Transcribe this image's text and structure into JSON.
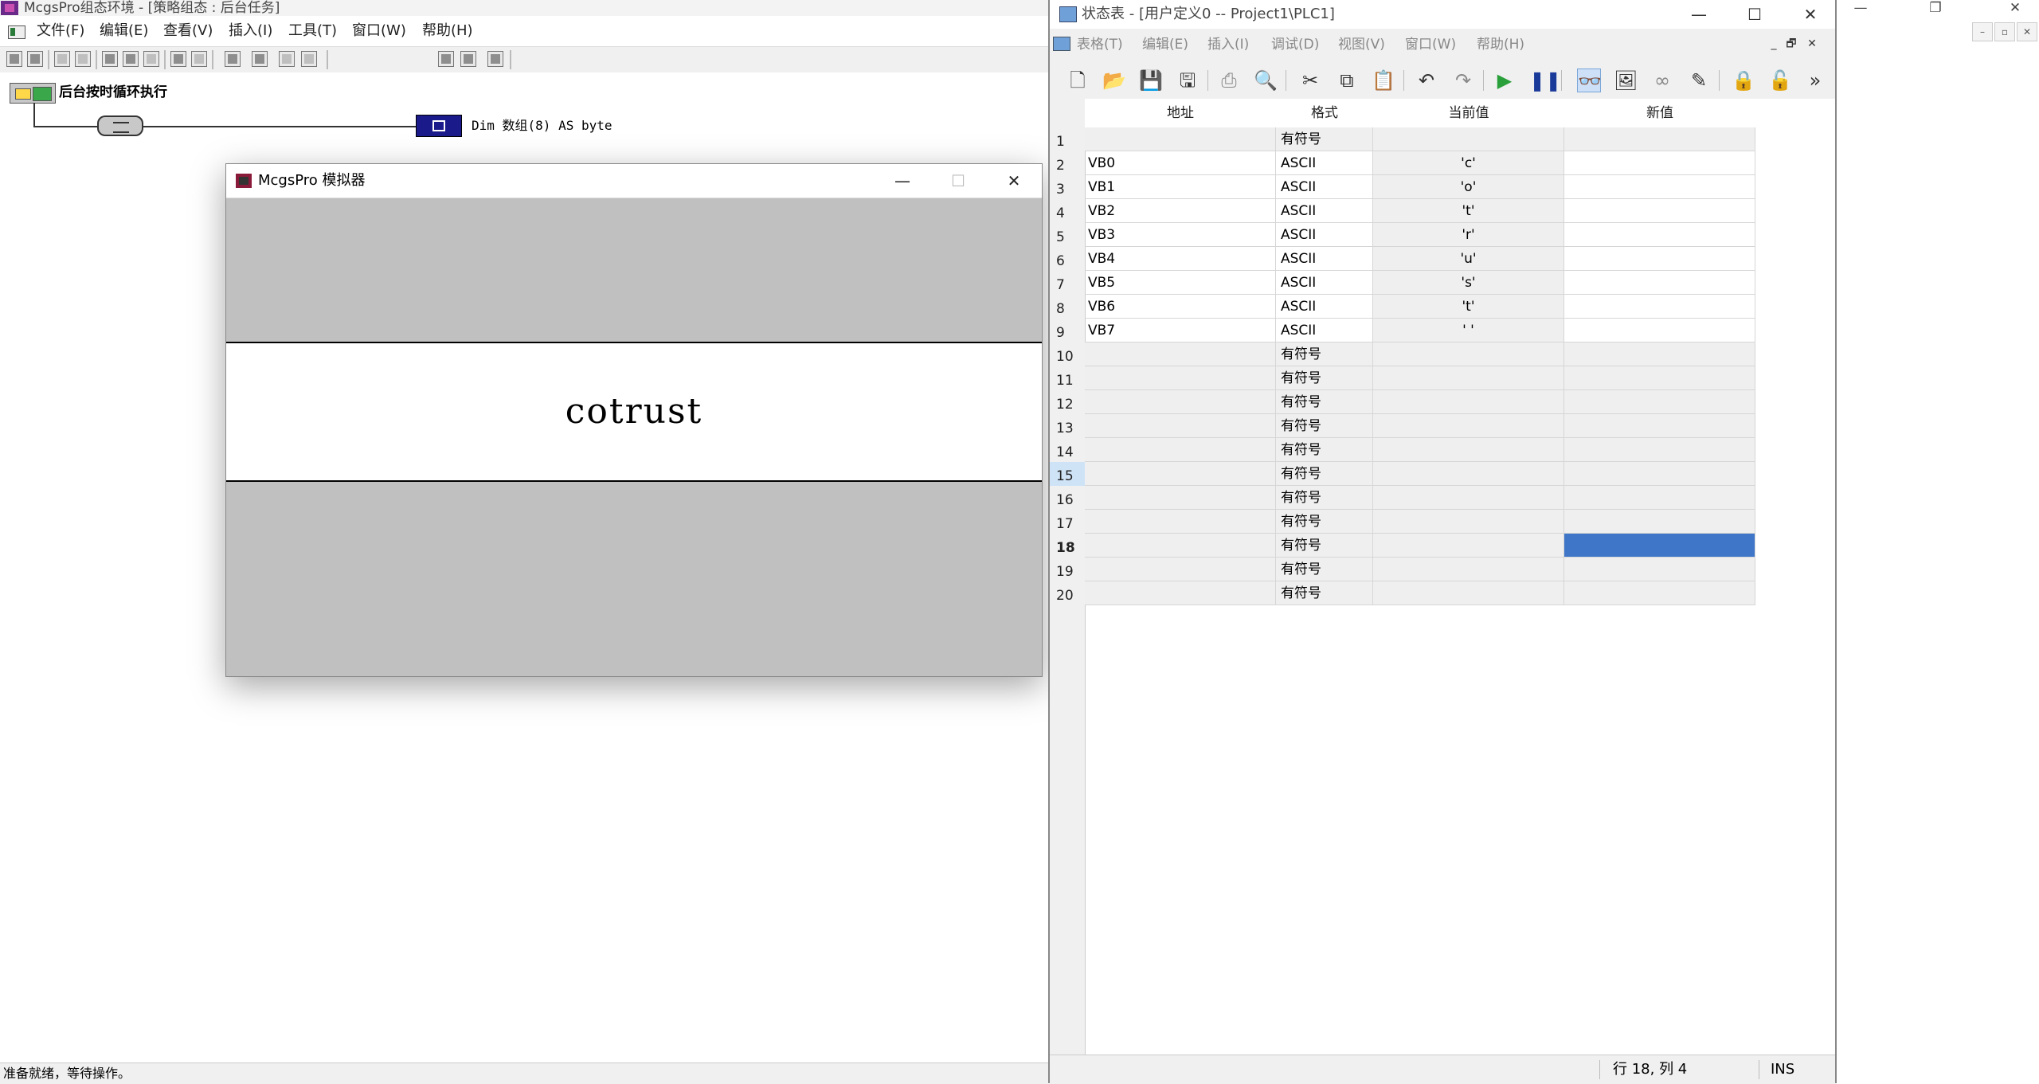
{
  "app": {
    "title": "McgsPro组态环境 - [策略组态 : 后台任务]",
    "menu": [
      "文件(F)",
      "编辑(E)",
      "查看(V)",
      "插入(I)",
      "工具(T)",
      "窗口(W)",
      "帮助(H)"
    ],
    "window_controls": {
      "minimize": "—",
      "restore": "❐",
      "close": "✕"
    },
    "strategy": {
      "name": "后台按时循环执行",
      "script_label": "Dim 数组(8) AS byte"
    },
    "status": "准备就绪，等待操作。"
  },
  "simulator": {
    "title": "McgsPro 模拟器",
    "controls": {
      "minimize": "—",
      "maximize": "☐",
      "close": "✕"
    },
    "display_text": "cotrust"
  },
  "status_table": {
    "title": "状态表 - [用户定义0 -- Project1\\PLC1]",
    "controls": {
      "minimize": "—",
      "maximize": "☐",
      "close": "✕"
    },
    "menu": [
      "表格(T)",
      "编辑(E)",
      "插入(I)",
      "调试(D)",
      "视图(V)",
      "窗口(W)",
      "帮助(H)"
    ],
    "mdi_controls": {
      "minimize": "_",
      "restore": "🗗",
      "close": "✕"
    },
    "toolbar_icons": [
      "new-icon",
      "open-icon",
      "save-icon",
      "save-all-icon",
      "print-icon",
      "print-preview-icon",
      "cut-icon",
      "copy-icon",
      "paste-icon",
      "undo-icon",
      "redo-icon",
      "run-icon",
      "pause-icon",
      "monitor-icon",
      "trend-icon",
      "watch-icon",
      "write-icon",
      "lock-icon",
      "unlock-icon",
      "more-icon"
    ],
    "columns": [
      "地址",
      "格式",
      "当前值",
      "新值"
    ],
    "rows": [
      {
        "num": "1",
        "addr": "",
        "fmt": "有符号",
        "cur": "",
        "new": ""
      },
      {
        "num": "2",
        "addr": "VB0",
        "fmt": "ASCII",
        "cur": "'c'",
        "new": ""
      },
      {
        "num": "3",
        "addr": "VB1",
        "fmt": "ASCII",
        "cur": "'o'",
        "new": ""
      },
      {
        "num": "4",
        "addr": "VB2",
        "fmt": "ASCII",
        "cur": "'t'",
        "new": ""
      },
      {
        "num": "5",
        "addr": "VB3",
        "fmt": "ASCII",
        "cur": "'r'",
        "new": ""
      },
      {
        "num": "6",
        "addr": "VB4",
        "fmt": "ASCII",
        "cur": "'u'",
        "new": ""
      },
      {
        "num": "7",
        "addr": "VB5",
        "fmt": "ASCII",
        "cur": "'s'",
        "new": ""
      },
      {
        "num": "8",
        "addr": "VB6",
        "fmt": "ASCII",
        "cur": "'t'",
        "new": ""
      },
      {
        "num": "9",
        "addr": "VB7",
        "fmt": "ASCII",
        "cur": "' '",
        "new": ""
      },
      {
        "num": "10",
        "addr": "",
        "fmt": "有符号",
        "cur": "",
        "new": ""
      },
      {
        "num": "11",
        "addr": "",
        "fmt": "有符号",
        "cur": "",
        "new": ""
      },
      {
        "num": "12",
        "addr": "",
        "fmt": "有符号",
        "cur": "",
        "new": ""
      },
      {
        "num": "13",
        "addr": "",
        "fmt": "有符号",
        "cur": "",
        "new": ""
      },
      {
        "num": "14",
        "addr": "",
        "fmt": "有符号",
        "cur": "",
        "new": ""
      },
      {
        "num": "15",
        "addr": "",
        "fmt": "有符号",
        "cur": "",
        "new": ""
      },
      {
        "num": "16",
        "addr": "",
        "fmt": "有符号",
        "cur": "",
        "new": ""
      },
      {
        "num": "17",
        "addr": "",
        "fmt": "有符号",
        "cur": "",
        "new": ""
      },
      {
        "num": "18",
        "addr": "",
        "fmt": "有符号",
        "cur": "",
        "new": ""
      },
      {
        "num": "19",
        "addr": "",
        "fmt": "有符号",
        "cur": "",
        "new": ""
      },
      {
        "num": "20",
        "addr": "",
        "fmt": "有符号",
        "cur": "",
        "new": ""
      }
    ],
    "selected_row": "18",
    "status_position": "行 18, 列 4",
    "status_mode": "INS"
  },
  "colors": {
    "selection": "#3f76c8",
    "row_highlight": "#cfe3f7",
    "script_icon": "#1a1a8a"
  }
}
